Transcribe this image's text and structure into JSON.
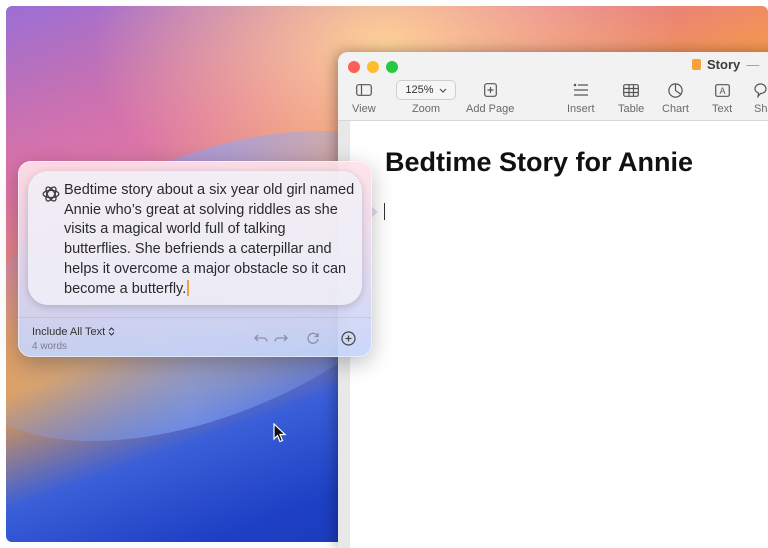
{
  "window": {
    "title": "Story",
    "title_suffix": "—"
  },
  "toolbar": {
    "view_label": "View",
    "zoom_value": "125%",
    "zoom_label": "Zoom",
    "add_page_label": "Add Page",
    "insert_label": "Insert",
    "table_label": "Table",
    "chart_label": "Chart",
    "text_label": "Text",
    "shape_label": "Sh"
  },
  "document": {
    "heading": "Bedtime Story for Annie"
  },
  "writing_tools": {
    "prompt": "Bedtime story about a six year old girl named Annie who’s great at solving riddles as she visits a magical world full of talking butterflies. She befriends a caterpillar and helps it overcome a major obstacle so it can become a butterfly.",
    "include_option": "Include All Text",
    "include_chevron": "⌃⌄",
    "word_count": "4 words"
  },
  "icons": {
    "prompt": "openai-logo-icon",
    "undo": "undo-icon",
    "redo": "redo-icon",
    "refresh": "refresh-icon",
    "add": "plus-circle-icon"
  },
  "colors": {
    "close": "#fe5f57",
    "minimize": "#febc2e",
    "zoom": "#28c840",
    "caret_accent": "#f2a03f"
  }
}
